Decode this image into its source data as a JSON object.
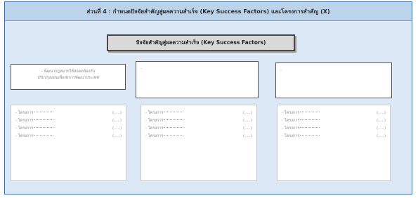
{
  "header": {
    "title": "ส่วนที่ 4 : กำหนดปัจจัยสำคัญสู่ผลความสำเร็จ (Key Success Factors) และโครงการสำคัญ (X)"
  },
  "ksf": {
    "title": "ปัจจัยสำคัญสู่ผลความสำเร็จ (Key Success Factors)"
  },
  "factors": [
    {
      "line1": "- พัฒนากฎหมายให้สอดคล้องกับ",
      "line2": "ปรับปรุงแผนเพื่อส่งการพัฒนาประเทศ"
    },
    {
      "line1": "-",
      "line2": ""
    },
    {
      "line1": "-",
      "line2": ""
    }
  ],
  "projects": [
    {
      "items": [
        {
          "name": "- โครงการ",
          "tag": "(.....)"
        },
        {
          "name": "- โครงการ",
          "tag": "(.....)"
        },
        {
          "name": "- โครงการ",
          "tag": "(.....)"
        },
        {
          "name": "- โครงการ",
          "tag": "(.....)"
        }
      ]
    },
    {
      "items": [
        {
          "name": "- โครงการ",
          "tag": "(.....)"
        },
        {
          "name": "- โครงการ",
          "tag": "(.....)"
        },
        {
          "name": "- โครงการ",
          "tag": "(.....)"
        },
        {
          "name": "- โครงการ",
          "tag": "(.....)"
        }
      ]
    },
    {
      "items": [
        {
          "name": "- โครงการ",
          "tag": "(.....)"
        },
        {
          "name": "- โครงการ",
          "tag": "(.....)"
        },
        {
          "name": "- โครงการ",
          "tag": "(.....)"
        },
        {
          "name": "- โครงการ",
          "tag": "(.....)"
        }
      ]
    }
  ]
}
